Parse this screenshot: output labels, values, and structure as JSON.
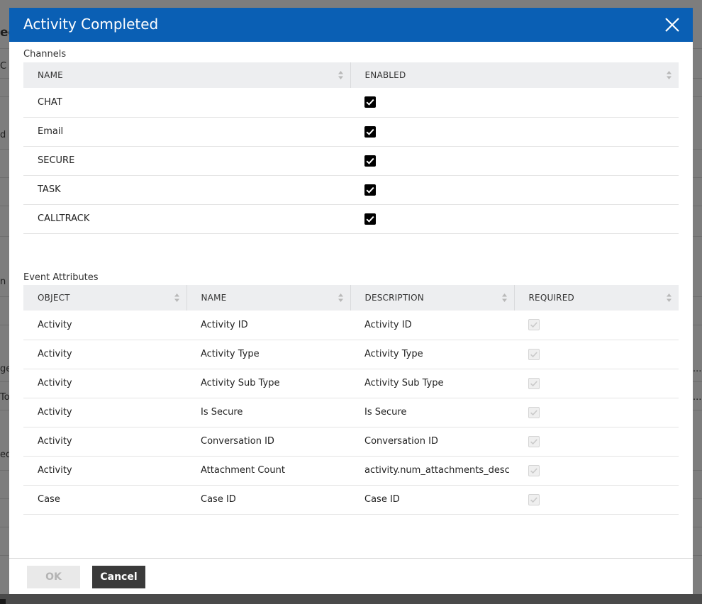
{
  "background": {
    "fragments_left": [
      "ec",
      "C",
      "d",
      "n",
      "ge",
      "To",
      "ed"
    ],
    "fragments_right": [
      "...",
      "..."
    ]
  },
  "dialog": {
    "title": "Activity Completed",
    "close_icon": "close-icon"
  },
  "channels": {
    "label": "Channels",
    "columns": [
      "NAME",
      "ENABLED"
    ],
    "rows": [
      {
        "name": "CHAT",
        "enabled": true
      },
      {
        "name": "Email",
        "enabled": true
      },
      {
        "name": "SECURE",
        "enabled": true
      },
      {
        "name": "TASK",
        "enabled": true
      },
      {
        "name": "CALLTRACK",
        "enabled": true
      }
    ]
  },
  "event_attributes": {
    "label": "Event Attributes",
    "columns": [
      "OBJECT",
      "NAME",
      "DESCRIPTION",
      "REQUIRED"
    ],
    "rows": [
      {
        "object": "Activity",
        "name": "Activity ID",
        "description": "Activity ID",
        "required": true
      },
      {
        "object": "Activity",
        "name": "Activity Type",
        "description": "Activity Type",
        "required": true
      },
      {
        "object": "Activity",
        "name": "Activity Sub Type",
        "description": "Activity Sub Type",
        "required": true
      },
      {
        "object": "Activity",
        "name": "Is Secure",
        "description": "Is Secure",
        "required": true
      },
      {
        "object": "Activity",
        "name": "Conversation ID",
        "description": "Conversation ID",
        "required": true
      },
      {
        "object": "Activity",
        "name": "Attachment Count",
        "description": "activity.num_attachments_desc",
        "required": true
      },
      {
        "object": "Case",
        "name": "Case ID",
        "description": "Case ID",
        "required": true
      }
    ]
  },
  "footer": {
    "ok_label": "OK",
    "cancel_label": "Cancel"
  },
  "colors": {
    "header": "#0a5fb4",
    "table_header": "#edeef0",
    "cancel_button": "#3a3a3a"
  }
}
